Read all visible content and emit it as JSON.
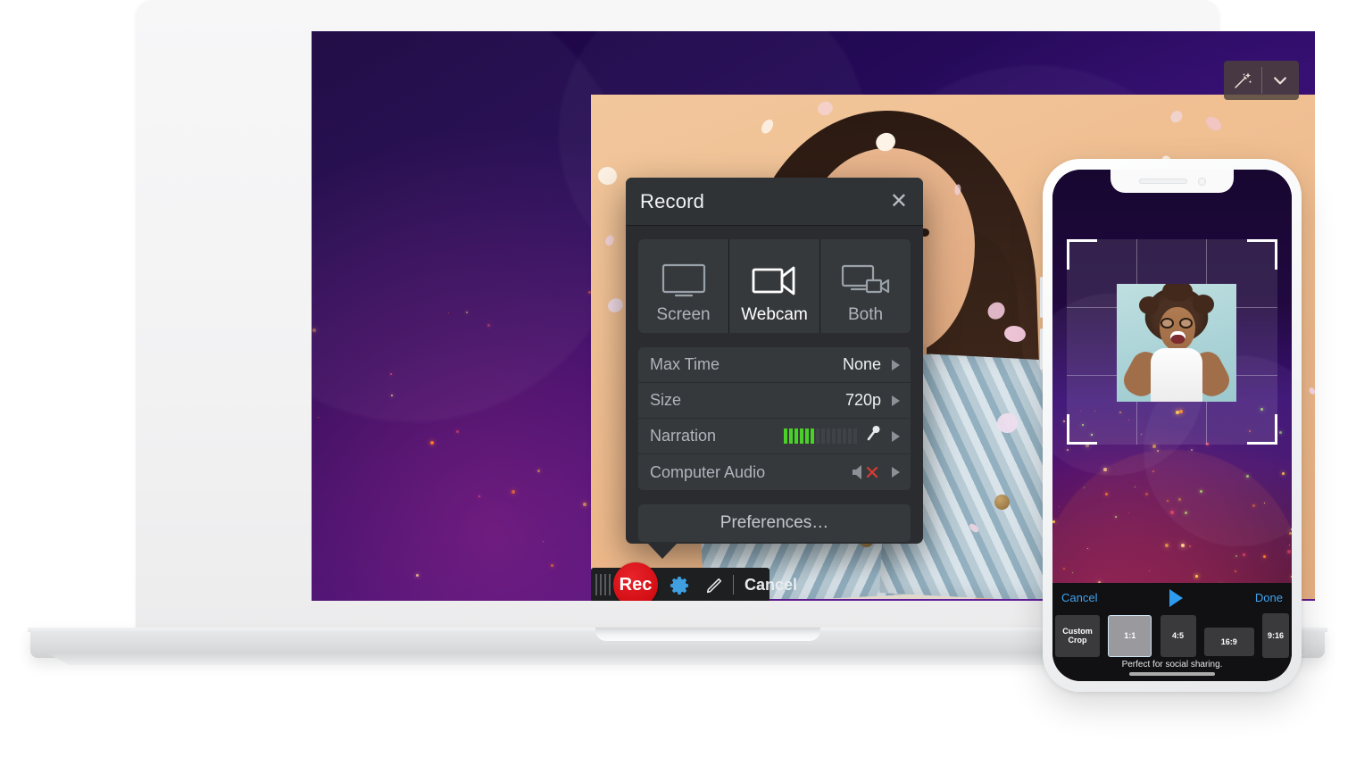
{
  "laptop": {
    "magic_toolbar": {
      "wand_icon": "magic-wand-icon",
      "chevron_icon": "chevron-down-icon"
    },
    "record_panel": {
      "title": "Record",
      "close_icon": "close-icon",
      "modes": [
        {
          "label": "Screen",
          "icon": "monitor-icon",
          "active": false
        },
        {
          "label": "Webcam",
          "icon": "video-camera-icon",
          "active": true
        },
        {
          "label": "Both",
          "icon": "monitor-and-camera-icon",
          "active": false
        }
      ],
      "settings": [
        {
          "label": "Max Time",
          "value": "None",
          "control": "chevron"
        },
        {
          "label": "Size",
          "value": "720p",
          "control": "chevron"
        },
        {
          "label": "Narration",
          "value": "",
          "control": "meter-mic-chevron",
          "meter_on": 6,
          "meter_total": 14,
          "mic_icon": "microphone-icon"
        },
        {
          "label": "Computer Audio",
          "value": "",
          "control": "mute-chevron",
          "mute_icon": "speaker-muted-icon"
        }
      ],
      "preferences_label": "Preferences…"
    },
    "rec_toolbar": {
      "grip_icon": "drag-handle-icon",
      "rec_label": "Rec",
      "gear_icon": "gear-icon",
      "pencil_icon": "pencil-icon",
      "cancel_label": "Cancel"
    }
  },
  "phone": {
    "notch": {
      "speaker_icon": "earpiece-speaker-icon",
      "camera_icon": "front-camera-icon"
    },
    "crop_overlay": {
      "name": "crop-frame-overlay"
    },
    "action_bar": {
      "cancel_label": "Cancel",
      "play_icon": "play-icon",
      "done_label": "Done",
      "hint": "Perfect for social sharing."
    },
    "ratios": [
      {
        "id": "custom",
        "label": "Custom\nCrop",
        "line1": "Custom",
        "line2": "Crop",
        "selected": false
      },
      {
        "id": "1-1",
        "label": "1:1",
        "selected": true
      },
      {
        "id": "4-5",
        "label": "4:5",
        "selected": false
      },
      {
        "id": "16-9",
        "label": "16:9",
        "selected": false
      },
      {
        "id": "9-16",
        "label": "9:16",
        "selected": false
      }
    ]
  },
  "colors": {
    "accent_blue": "#3fa3f0",
    "rec_red": "#c9050c",
    "meter_green": "#49d127",
    "panel_bg": "#2a2c2f",
    "wallpaper_purple": "#3a1079",
    "webcam_bg": "#eeba8c"
  }
}
